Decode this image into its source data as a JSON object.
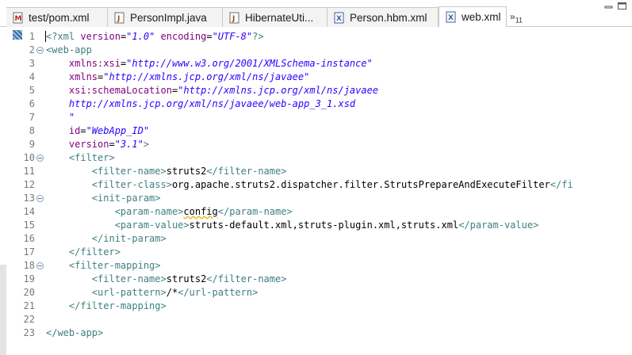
{
  "tabs": [
    {
      "label": "test/pom.xml",
      "icon": "maven-pom-icon",
      "active": false
    },
    {
      "label": "PersonImpl.java",
      "icon": "java-file-icon",
      "active": false
    },
    {
      "label": "HibernateUti...",
      "icon": "java-file-icon",
      "active": false
    },
    {
      "label": "Person.hbm.xml",
      "icon": "xml-file-icon",
      "active": false
    },
    {
      "label": "web.xml",
      "icon": "xml-file-icon",
      "active": true,
      "close": "⊠"
    }
  ],
  "overflow": {
    "symbol": "»",
    "count": "11"
  },
  "colors": {
    "tag": "#3f7f7f",
    "attribute": "#7f007f",
    "value": "#2a00ff",
    "text": "#000000",
    "line_number": "#787878"
  },
  "editor": {
    "lines": [
      {
        "n": "1",
        "fold": false,
        "tokens": [
          [
            "pi",
            "<?xml "
          ],
          [
            "attr",
            "version"
          ],
          [
            "eq",
            "="
          ],
          [
            "val",
            "\"1.0\""
          ],
          [
            "attr",
            " encoding"
          ],
          [
            "eq",
            "="
          ],
          [
            "val",
            "\"UTF-8\""
          ],
          [
            "pi",
            "?>"
          ]
        ]
      },
      {
        "n": "2",
        "fold": true,
        "tokens": [
          [
            "tag",
            "<web-app"
          ]
        ]
      },
      {
        "n": "3",
        "fold": false,
        "tokens": [
          [
            "text",
            "    "
          ],
          [
            "attr",
            "xmlns:xsi"
          ],
          [
            "eq",
            "="
          ],
          [
            "val",
            "\"http://www.w3.org/2001/XMLSchema-instance\""
          ]
        ]
      },
      {
        "n": "4",
        "fold": false,
        "tokens": [
          [
            "text",
            "    "
          ],
          [
            "attr",
            "xmlns"
          ],
          [
            "eq",
            "="
          ],
          [
            "val",
            "\"http://xmlns.jcp.org/xml/ns/javaee\""
          ]
        ]
      },
      {
        "n": "5",
        "fold": false,
        "tokens": [
          [
            "text",
            "    "
          ],
          [
            "attr",
            "xsi:schemaLocation"
          ],
          [
            "eq",
            "="
          ],
          [
            "val",
            "\"http://xmlns.jcp.org/xml/ns/javaee"
          ]
        ]
      },
      {
        "n": "6",
        "fold": false,
        "tokens": [
          [
            "text",
            "    "
          ],
          [
            "val",
            "http://xmlns.jcp.org/xml/ns/javaee/web-app_3_1.xsd"
          ]
        ]
      },
      {
        "n": "7",
        "fold": false,
        "tokens": [
          [
            "text",
            "    "
          ],
          [
            "val",
            "\""
          ]
        ]
      },
      {
        "n": "8",
        "fold": false,
        "tokens": [
          [
            "text",
            "    "
          ],
          [
            "attr",
            "id"
          ],
          [
            "eq",
            "="
          ],
          [
            "val",
            "\"WebApp_ID\""
          ]
        ]
      },
      {
        "n": "9",
        "fold": false,
        "tokens": [
          [
            "text",
            "    "
          ],
          [
            "attr",
            "version"
          ],
          [
            "eq",
            "="
          ],
          [
            "val",
            "\"3.1\""
          ],
          [
            "tag",
            ">"
          ]
        ]
      },
      {
        "n": "10",
        "fold": true,
        "tokens": [
          [
            "text",
            "    "
          ],
          [
            "tag",
            "<filter>"
          ]
        ]
      },
      {
        "n": "11",
        "fold": false,
        "tokens": [
          [
            "text",
            "        "
          ],
          [
            "tag",
            "<filter-name>"
          ],
          [
            "text",
            "struts2"
          ],
          [
            "tag",
            "</filter-name>"
          ]
        ]
      },
      {
        "n": "12",
        "fold": false,
        "tokens": [
          [
            "text",
            "        "
          ],
          [
            "tag",
            "<filter-class>"
          ],
          [
            "text",
            "org.apache.struts2.dispatcher.filter.StrutsPrepareAndExecuteFilter"
          ],
          [
            "tag",
            "</fi"
          ]
        ]
      },
      {
        "n": "13",
        "fold": true,
        "tokens": [
          [
            "text",
            "        "
          ],
          [
            "tag",
            "<init-param>"
          ]
        ]
      },
      {
        "n": "14",
        "fold": false,
        "tokens": [
          [
            "text",
            "            "
          ],
          [
            "tag",
            "<param-name>"
          ],
          [
            "sq",
            "config"
          ],
          [
            "tag",
            "</param-name>"
          ]
        ]
      },
      {
        "n": "15",
        "fold": false,
        "tokens": [
          [
            "text",
            "            "
          ],
          [
            "tag",
            "<param-value>"
          ],
          [
            "text",
            "struts-default.xml,struts-plugin.xml,struts.xml"
          ],
          [
            "tag",
            "</param-value>"
          ]
        ]
      },
      {
        "n": "16",
        "fold": false,
        "tokens": [
          [
            "text",
            "        "
          ],
          [
            "tag",
            "</init-param>"
          ]
        ]
      },
      {
        "n": "17",
        "fold": false,
        "tokens": [
          [
            "text",
            "    "
          ],
          [
            "tag",
            "</filter>"
          ]
        ]
      },
      {
        "n": "18",
        "fold": true,
        "tokens": [
          [
            "text",
            "    "
          ],
          [
            "tag",
            "<filter-mapping>"
          ]
        ]
      },
      {
        "n": "19",
        "fold": false,
        "tokens": [
          [
            "text",
            "        "
          ],
          [
            "tag",
            "<filter-name>"
          ],
          [
            "text",
            "struts2"
          ],
          [
            "tag",
            "</filter-name>"
          ]
        ]
      },
      {
        "n": "20",
        "fold": false,
        "tokens": [
          [
            "text",
            "        "
          ],
          [
            "tag",
            "<url-pattern>"
          ],
          [
            "text",
            "/*"
          ],
          [
            "tag",
            "</url-pattern>"
          ]
        ]
      },
      {
        "n": "21",
        "fold": false,
        "tokens": [
          [
            "text",
            "    "
          ],
          [
            "tag",
            "</filter-mapping>"
          ]
        ]
      },
      {
        "n": "22",
        "fold": false,
        "tokens": []
      },
      {
        "n": "23",
        "fold": false,
        "tokens": [
          [
            "tag",
            "</web-app>"
          ]
        ]
      }
    ]
  }
}
